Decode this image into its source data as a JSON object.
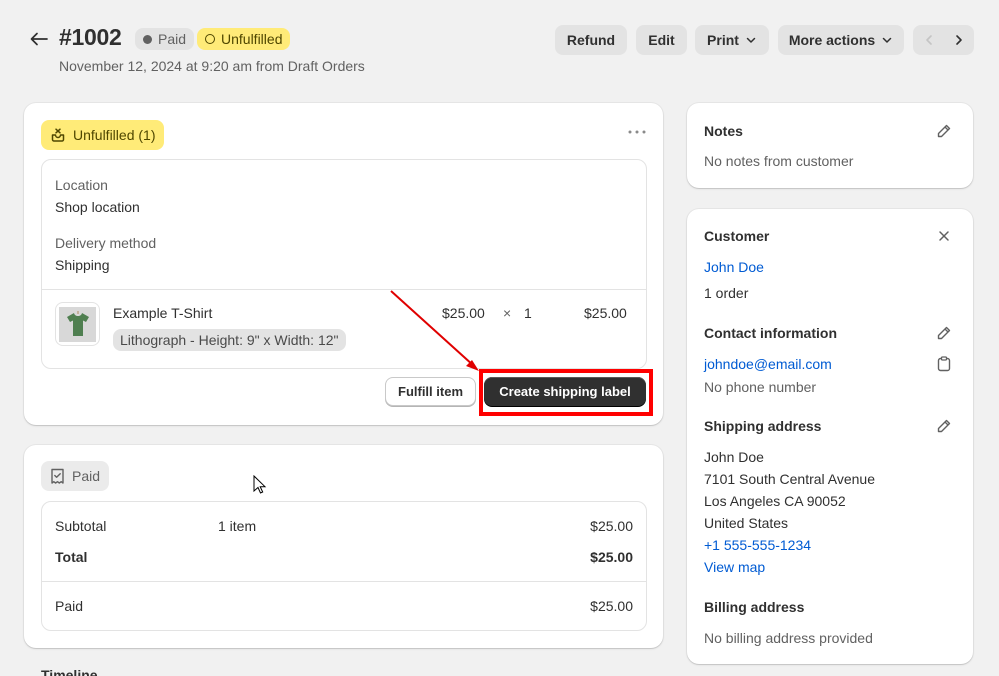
{
  "header": {
    "title": "#1002",
    "badges": {
      "payment": "Paid",
      "fulfillment": "Unfulfilled"
    },
    "subtitle": "November 12, 2024 at 9:20 am from Draft Orders",
    "actions": {
      "refund": "Refund",
      "edit": "Edit",
      "print": "Print",
      "more_actions": "More actions"
    }
  },
  "fulfillment_card": {
    "status_pill": "Unfulfilled (1)",
    "location_label": "Location",
    "location_value": "Shop location",
    "delivery_label": "Delivery method",
    "delivery_value": "Shipping",
    "line_item": {
      "name": "Example T-Shirt",
      "variant": "Lithograph - Height: 9\" x Width: 12\"",
      "unit_price": "$25.00",
      "times": "×",
      "quantity": "1",
      "total": "$25.00"
    },
    "fulfill_button": "Fulfill item",
    "shipping_label_button": "Create shipping label"
  },
  "payment_card": {
    "status_pill": "Paid",
    "rows": [
      {
        "label": "Subtotal",
        "detail": "1 item",
        "amount": "$25.00"
      },
      {
        "label": "Total",
        "detail": "",
        "amount": "$25.00"
      },
      {
        "label": "Paid",
        "detail": "",
        "amount": "$25.00"
      }
    ]
  },
  "timeline_heading": "Timeline",
  "notes": {
    "title": "Notes",
    "body": "No notes from customer"
  },
  "customer": {
    "title": "Customer",
    "name": "John Doe",
    "orders": "1 order",
    "contact_title": "Contact information",
    "email": "johndoe@email.com",
    "phone": "No phone number",
    "shipping_title": "Shipping address",
    "shipping_lines": [
      "John Doe",
      "7101 South Central Avenue",
      "Los Angeles CA 90052",
      "United States"
    ],
    "shipping_phone": "+1 555-555-1234",
    "view_map": "View map",
    "billing_title": "Billing address",
    "billing_body": "No billing address provided"
  },
  "colors": {
    "accent_link": "#005bd3",
    "unfulfilled_badge": "#ffeb78",
    "annotation": "#ff0000",
    "primary_button": "#303030"
  }
}
